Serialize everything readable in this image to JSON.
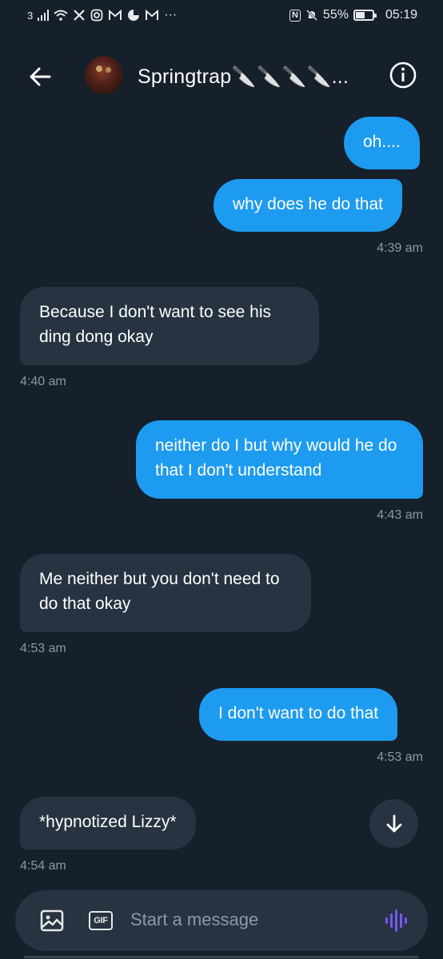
{
  "status_bar": {
    "carrier": "3",
    "icons": [
      "signal-icon",
      "wifi-icon",
      "x-logo-icon",
      "instagram-icon",
      "gmail-icon",
      "app-icon",
      "gmail-icon"
    ],
    "more": "···",
    "nfc": "N",
    "battery_percent": "55%",
    "battery_level": 0.55,
    "time": "05:19"
  },
  "header": {
    "back_icon": "arrow-left-icon",
    "contact_name": "Springtrap🔪🔪🔪🔪...",
    "info_icon": "info-icon"
  },
  "messages": [
    {
      "direction": "sent",
      "text": "oh....",
      "time": ""
    },
    {
      "direction": "sent",
      "text": "why does he do that",
      "time": "4:39 am"
    },
    {
      "direction": "received",
      "text": "Because I don't want to see his ding dong okay",
      "time": "4:40 am"
    },
    {
      "direction": "sent",
      "text": "neither do I but why would he do that I don't understand",
      "time": "4:43 am"
    },
    {
      "direction": "received",
      "text": "Me neither but you don't need to do that okay",
      "time": "4:53 am"
    },
    {
      "direction": "sent",
      "text": "I don't want to do that",
      "time": "4:53 am"
    },
    {
      "direction": "received",
      "text": "*hypnotized Lizzy*",
      "time": "4:54 am"
    }
  ],
  "composer": {
    "placeholder": "Start a message",
    "gif_label": "GIF",
    "accent_color": "#7856ff"
  },
  "colors": {
    "background": "#15202b",
    "sent_bubble": "#1d9bf0",
    "received_bubble": "#273340",
    "muted_text": "#8b98a5"
  }
}
